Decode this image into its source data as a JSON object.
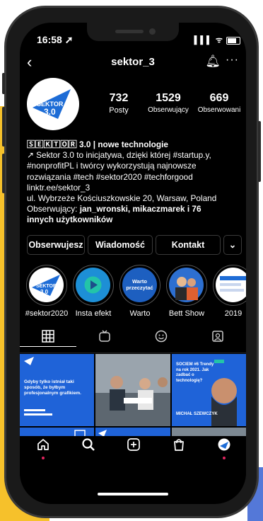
{
  "colors": {
    "accent": "#1d6cd6",
    "background": "#000000",
    "text": "#ffffff"
  },
  "status_bar": {
    "time": "16:58 ➚",
    "icons": "▌▌▌ ᯤ"
  },
  "header": {
    "username": "sektor_3",
    "back_icon": "chevron-left-icon",
    "bell_icon": "bell-icon",
    "more_icon": "more-icon"
  },
  "profile": {
    "avatar_text": "SEKTOR 3.0",
    "stats": [
      {
        "value": "732",
        "label": "Posty"
      },
      {
        "value": "1529",
        "label": "Obserwujący"
      },
      {
        "value": "669",
        "label": "Obserwowani"
      }
    ]
  },
  "bio": {
    "name": "🅂🄴🄺🅃🄾🅁 3.0 | nowe technologie",
    "line1": "↗ Sektor 3.0 to inicjatywa, dzięki której #startup.y,",
    "line2": "#nonprofitPL i twórcy wykorzystują najnowsze",
    "line3": "rozwiązania #tech #sektor2020 #techforgood",
    "link": "linktr.ee/sektor_3",
    "address": "ul. Wybrzeże Kościuszkowskie 20, Warsaw, Poland",
    "followers_prefix": "Obserwujący: ",
    "followers_names": "jan_wronski, mikaczmarek i 76",
    "followers_suffix": "innych użytkowników"
  },
  "actions": {
    "following": "Obserwujesz",
    "message": "Wiadomość",
    "contact": "Kontakt",
    "more": "⌄"
  },
  "highlights": [
    {
      "label": "#sektor2020"
    },
    {
      "label": "Insta efekt"
    },
    {
      "label": "Warto",
      "inner": "Warto przeczytać"
    },
    {
      "label": "Bett Show"
    },
    {
      "label": "2019"
    }
  ],
  "grid_posts": [
    {
      "text": "Gdyby tylko istniał taki sposób, że byłbym profesjonalnym grafikiem."
    },
    {
      "text": ""
    },
    {
      "text": "SOCIEM #6 Trendy na rok 2021. Jak zadbać o technologię?",
      "name": "MICHAŁ SZEWCZYK"
    }
  ],
  "nav": [
    "home-icon",
    "search-icon",
    "plus-icon",
    "shop-icon",
    "profile-icon"
  ]
}
